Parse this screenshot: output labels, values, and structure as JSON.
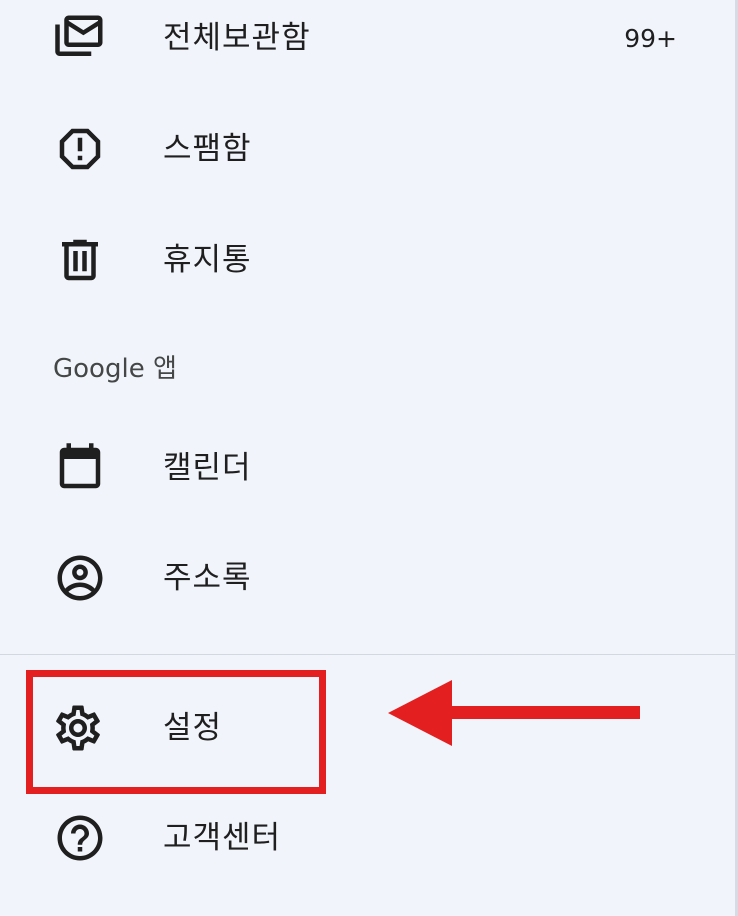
{
  "drawer": {
    "items": [
      {
        "label": "전체보관함",
        "icon": "all-mail-icon",
        "count": "99+"
      },
      {
        "label": "스팸함",
        "icon": "spam-icon"
      },
      {
        "label": "휴지통",
        "icon": "trash-icon"
      }
    ],
    "section_header": "Google 앱",
    "app_items": [
      {
        "label": "캘린더",
        "icon": "calendar-icon"
      },
      {
        "label": "주소록",
        "icon": "contacts-icon"
      }
    ],
    "bottom_items": [
      {
        "label": "설정",
        "icon": "gear-icon"
      },
      {
        "label": "고객센터",
        "icon": "help-icon"
      }
    ]
  },
  "annotation": {
    "highlight_color": "#e3201f",
    "arrow_color": "#e3201f"
  }
}
